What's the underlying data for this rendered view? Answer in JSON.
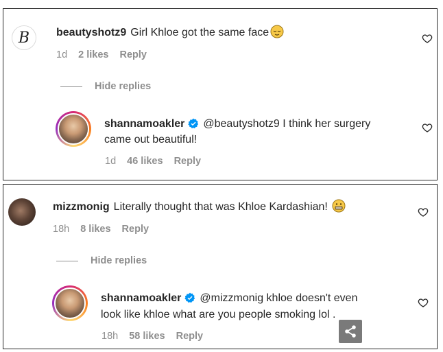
{
  "comments": [
    {
      "username": "beautyshotz9",
      "avatar_letter": "B",
      "text": "Girl Khloe got the same face",
      "emoji_icon": "relieved-face-emoji",
      "time": "1d",
      "likes": "2 likes",
      "reply": "Reply",
      "hide_replies": "Hide replies",
      "reply_comment": {
        "username": "shannamoakler",
        "mention": "@beautyshotz9",
        "text_line1": "I think her surgery",
        "text_line2": "came out beautiful!",
        "time": "1d",
        "likes": "46 likes",
        "reply": "Reply"
      }
    },
    {
      "username": "mizzmonig",
      "text": "Literally thought that was Khloe Kardashian!",
      "emoji_icon": "grimacing-face-emoji",
      "time": "18h",
      "likes": "8 likes",
      "reply": "Reply",
      "hide_replies": "Hide replies",
      "reply_comment": {
        "username": "shannamoakler",
        "mention": "@mizzmonig",
        "text_line1": "khloe doesn't even",
        "text_line2": "look like khloe what are you people smoking lol .",
        "time": "18h",
        "likes": "58 likes",
        "reply": "Reply"
      }
    }
  ],
  "colors": {
    "text": "#262626",
    "muted": "#8e8e8e",
    "verified": "#0095f6",
    "border": "#262626"
  },
  "share_icon": "share-icon"
}
